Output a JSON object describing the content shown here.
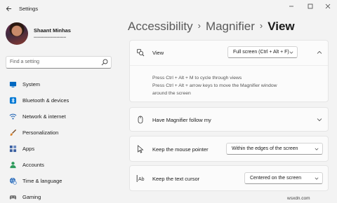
{
  "window": {
    "title": "Settings",
    "back_icon": "arrow-left-icon",
    "controls": [
      "minimize-icon",
      "maximize-icon",
      "close-icon"
    ]
  },
  "profile": {
    "name": "Shaant Minhas",
    "email": "••••••••••••••••••••••••"
  },
  "search": {
    "placeholder": "Find a setting",
    "icon": "search-icon"
  },
  "nav": {
    "items": [
      {
        "label": "System",
        "icon": "monitor-icon",
        "color": "#0067c0"
      },
      {
        "label": "Bluetooth & devices",
        "icon": "bluetooth-icon",
        "color": "#0078d4"
      },
      {
        "label": "Network & internet",
        "icon": "wifi-icon",
        "color": "#2b6bb8"
      },
      {
        "label": "Personalization",
        "icon": "brush-icon",
        "color": "#c0702a"
      },
      {
        "label": "Apps",
        "icon": "apps-icon",
        "color": "#3a5fa0"
      },
      {
        "label": "Accounts",
        "icon": "person-icon",
        "color": "#2e9a5c"
      },
      {
        "label": "Time & language",
        "icon": "globe-clock-icon",
        "color": "#2b6bb8"
      },
      {
        "label": "Gaming",
        "icon": "gamepad-icon",
        "color": "#6a6a6a"
      }
    ]
  },
  "breadcrumb": {
    "parts": [
      "Accessibility",
      "Magnifier"
    ],
    "current": "View",
    "separator": "›"
  },
  "settings": {
    "view": {
      "label": "View",
      "icon": "magnifier-view-icon",
      "value": "Full screen (Ctrl + Alt + F)",
      "expanded": true,
      "help_line1": "Press Ctrl + Alt + M to cycle through views",
      "help_line2": "Press Ctrl + Alt + arrow keys to move the Magnifier window",
      "help_line3": "around the screen"
    },
    "follow": {
      "label": "Have Magnifier follow my",
      "icon": "mouse-icon",
      "expanded": false
    },
    "mouse_pointer": {
      "label": "Keep the mouse pointer",
      "icon": "pointer-icon",
      "value": "Within the edges of the screen"
    },
    "text_cursor": {
      "label": "Keep the text cursor",
      "icon": "text-cursor-icon",
      "value": "Centered on the screen"
    }
  },
  "watermark": "wsxdn.com",
  "colors": {
    "background": "#f3f3f3",
    "card": "#fbfbfb",
    "accent": "#0067c0"
  }
}
